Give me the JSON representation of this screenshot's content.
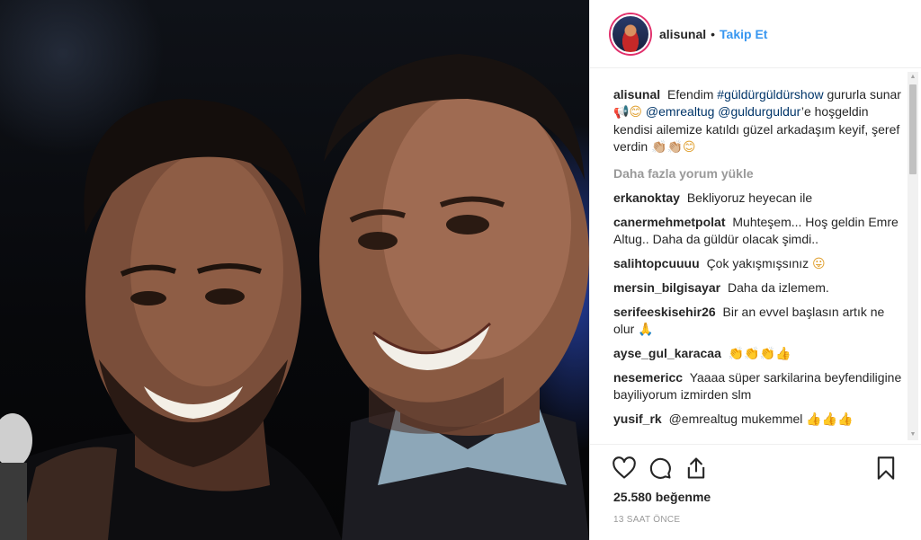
{
  "post": {
    "username": "alisunal",
    "separator": "•",
    "follow_label": "Takip Et"
  },
  "caption": {
    "username": "alisunal",
    "text_1": "Efendim",
    "hashtag": "#güldürgüldürshow",
    "text_2": "gururla sunar",
    "emoji_1": "📢😊",
    "mention_1": "@emrealtug",
    "mention_2": "@guldurguldur",
    "text_3": "’e hoşgeldin kendisi ailemize katıldı güzel arkadaşım keyif, şeref verdin",
    "emoji_2": "👏🏼👏🏼😊"
  },
  "load_more_label": "Daha fazla yorum yükle",
  "comments": [
    {
      "user": "erkanoktay",
      "text": "Bekliyoruz heyecan ile",
      "emoji": ""
    },
    {
      "user": "canermehmetpolat",
      "text": "Muhteşem... Hoş geldin Emre Altug.. Daha da güldür olacak şimdi..",
      "emoji": ""
    },
    {
      "user": "salihtopcuuuu",
      "text": "Çok yakışmışsınız",
      "emoji": "😛"
    },
    {
      "user": "mersin_bilgisayar",
      "text": "Daha da izlemem.",
      "emoji": ""
    },
    {
      "user": "serifeeskisehir26",
      "text": "Bir an evvel başlasın artık ne olur",
      "emoji": "🙏"
    },
    {
      "user": "ayse_gul_karacaa",
      "text": "",
      "emoji": "👏👏👏👍"
    },
    {
      "user": "nesemericc",
      "text": "Yaaaa süper sarkilarina beyfendiligine bayiliyorum izmirden slm",
      "emoji": ""
    },
    {
      "user": "yusif_rk",
      "text": "@emrealtug mukemmel",
      "emoji": "👍👍👍"
    }
  ],
  "likes_label": "25.580 beğenme",
  "time_label": "13 SAAT ÖNCE",
  "icons": {
    "like": "heart-icon",
    "comment": "comment-icon",
    "share": "share-icon",
    "save": "bookmark-icon"
  },
  "colors": {
    "link": "#3897f0",
    "mention": "#003569",
    "muted": "#999999",
    "text": "#262626"
  }
}
